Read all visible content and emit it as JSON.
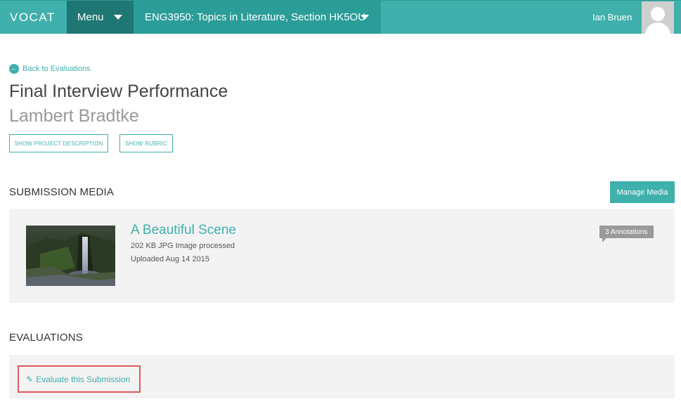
{
  "nav": {
    "logo": "VOCAT",
    "menu_label": "Menu",
    "course_label": "ENG3950: Topics in Literature, Section HK5OU",
    "user_name": "Ian Bruen"
  },
  "page": {
    "back_link": "Back to Evaluations",
    "title": "Final Interview Performance",
    "student": "Lambert Bradtke",
    "btn_project_description": "SHOW PROJECT DESCRIPTION",
    "btn_rubric": "SHOW RUBRIC"
  },
  "media": {
    "section_title": "SUBMISSION MEDIA",
    "manage_label": "Manage Media",
    "item_title": "A Beautiful Scene",
    "item_meta": "202 KB JPG Image processed",
    "item_uploaded": "Uploaded Aug 14 2015",
    "annotations_label": "3 Annotations"
  },
  "evaluations": {
    "section_title": "EVALUATIONS",
    "evaluate_label": "Evaluate this Submission"
  },
  "colors": {
    "accent": "#3fb0ac",
    "menu_dark": "#1e7772",
    "highlight": "#e05a5a"
  },
  "icons": {
    "back": "arrow-left-circle-icon",
    "menu_caret": "caret-down-icon",
    "course_caret": "caret-down-icon",
    "avatar": "user-avatar-icon",
    "pencil": "pencil-icon"
  }
}
